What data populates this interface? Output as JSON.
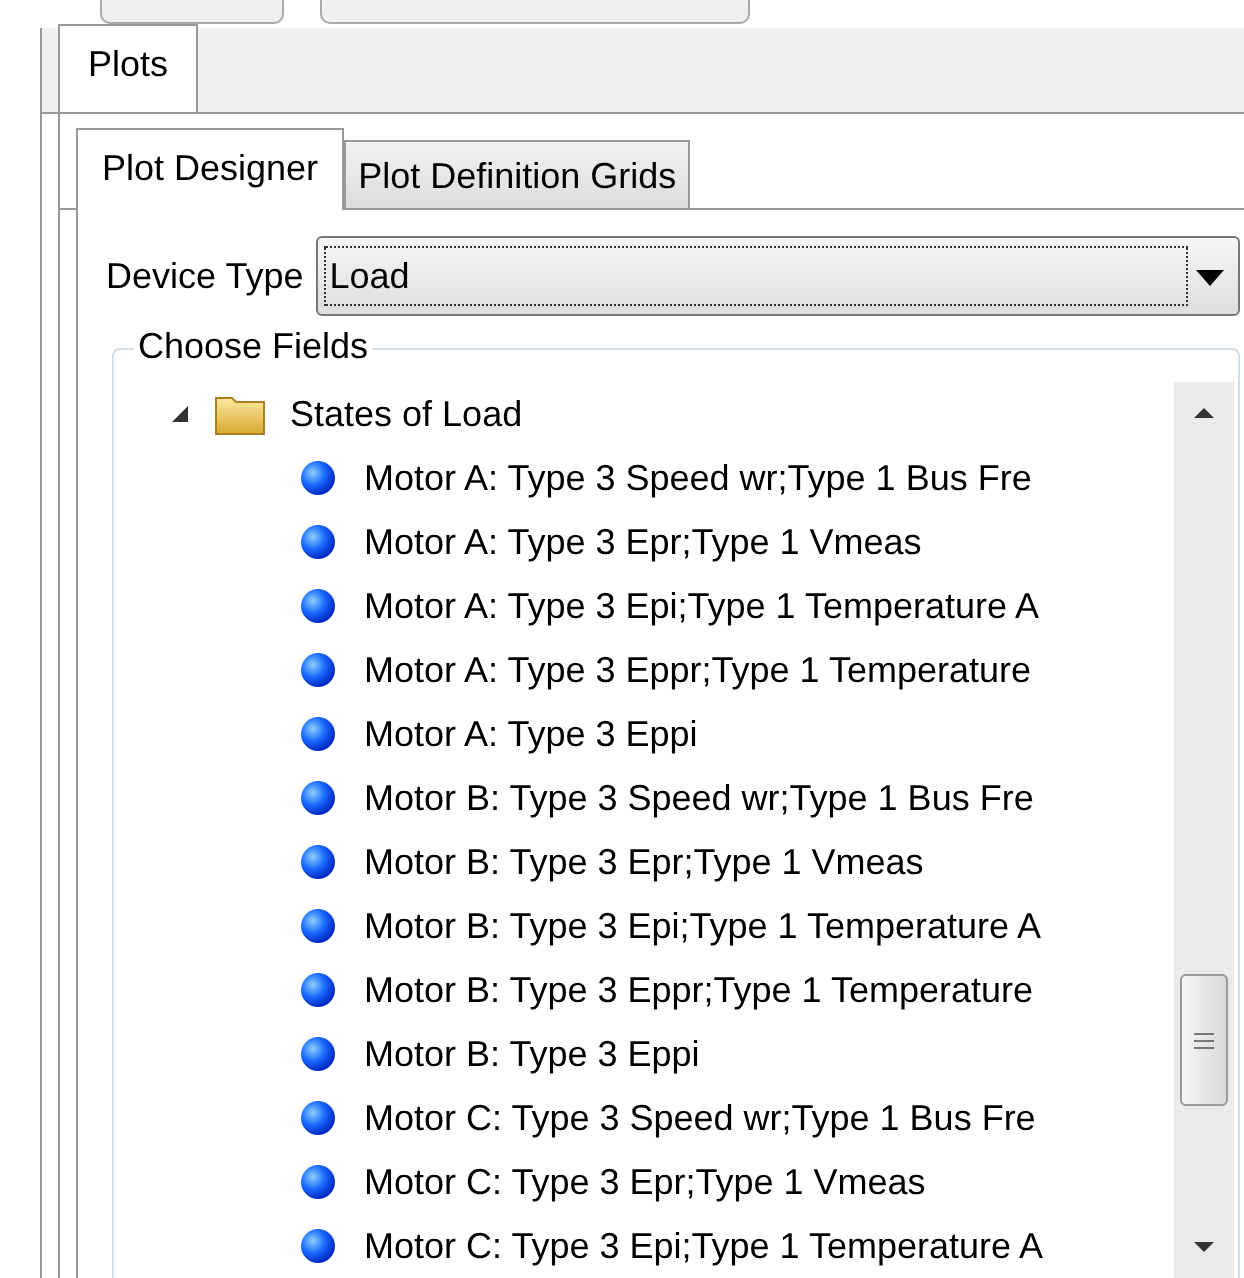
{
  "outer_tabs": [
    {
      "label": "Plots",
      "selected": true
    }
  ],
  "inner_tabs": [
    {
      "label": "Plot Designer",
      "selected": true
    },
    {
      "label": "Plot Definition Grids",
      "selected": false
    }
  ],
  "device_type": {
    "label": "Device Type",
    "value": "Load"
  },
  "choose_fields": {
    "legend": "Choose Fields",
    "tree": [
      {
        "label": "States of Load",
        "expanded": true,
        "children": [
          {
            "label": "Motor A: Type 3 Speed wr;Type 1 Bus Fre"
          },
          {
            "label": "Motor A: Type 3 Epr;Type 1 Vmeas"
          },
          {
            "label": "Motor A: Type 3 Epi;Type 1 Temperature A"
          },
          {
            "label": "Motor A: Type 3 Eppr;Type 1 Temperature"
          },
          {
            "label": "Motor A: Type 3 Eppi"
          },
          {
            "label": "Motor B: Type 3 Speed wr;Type 1 Bus Fre"
          },
          {
            "label": "Motor B: Type 3 Epr;Type 1 Vmeas"
          },
          {
            "label": "Motor B: Type 3 Epi;Type 1 Temperature A"
          },
          {
            "label": "Motor B: Type 3 Eppr;Type 1 Temperature"
          },
          {
            "label": "Motor B: Type 3 Eppi"
          },
          {
            "label": "Motor C: Type 3 Speed wr;Type 1 Bus Fre"
          },
          {
            "label": "Motor C: Type 3 Epr;Type 1 Vmeas"
          },
          {
            "label": "Motor C: Type 3 Epi;Type 1 Temperature A"
          }
        ]
      }
    ]
  }
}
